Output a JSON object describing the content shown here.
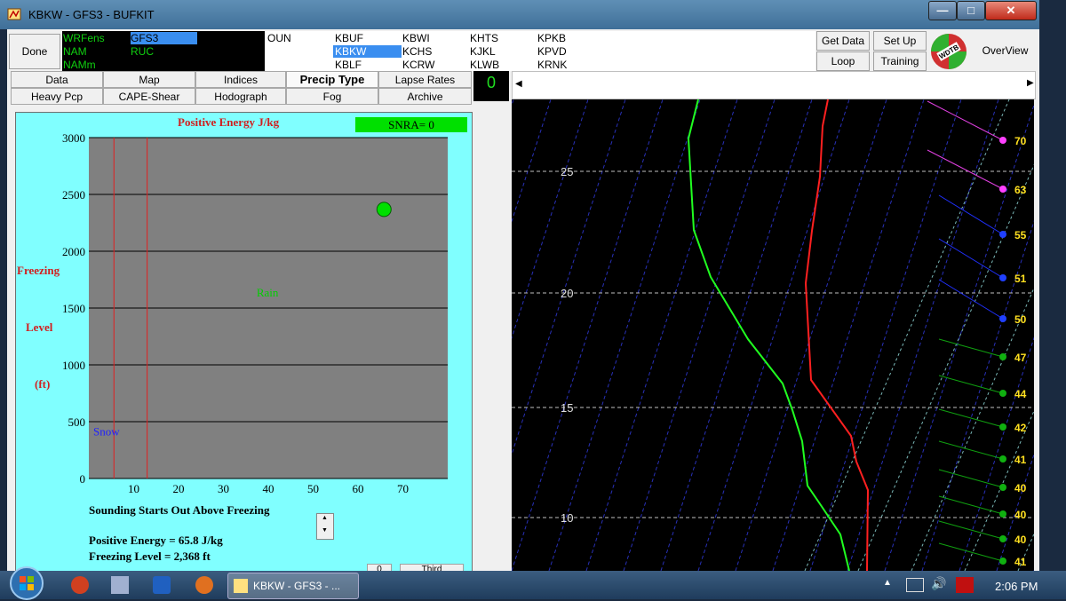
{
  "window": {
    "title": "KBKW - GFS3 - BUFKIT"
  },
  "controls": {
    "done": "Done"
  },
  "models": {
    "col1": [
      "WRFens",
      "NAM",
      "NAMm"
    ],
    "col2": [
      "GFS3",
      "RUC"
    ]
  },
  "stations": {
    "col0": [
      "OUN"
    ],
    "col1": [
      "KBUF",
      "KBKW",
      "KBLF"
    ],
    "col2": [
      "KBWI",
      "KCHS",
      "KCRW"
    ],
    "col3": [
      "KHTS",
      "KJKL",
      "KLWB"
    ],
    "col4": [
      "KPKB",
      "KPVD",
      "KRNK"
    ],
    "selected": "KBKW"
  },
  "right_buttons": {
    "get_data": "Get Data",
    "set_up": "Set Up",
    "loop": "Loop",
    "training": "Training",
    "overview": "OverView",
    "logo": "WDTB"
  },
  "tabs": {
    "row1": [
      "Data",
      "Map",
      "Indices",
      "Precip Type",
      "Lapse Rates"
    ],
    "row2": [
      "Heavy Pcp",
      "CAPE-Shear",
      "Hodograph",
      "Fog",
      "Archive"
    ]
  },
  "counter": "0",
  "energy_panel": {
    "title": "Positive Energy J/kg",
    "snra": "SNRA= 0",
    "ylabel": [
      "Freezing",
      "Level",
      "(ft)"
    ],
    "region_rain": "Rain",
    "region_snow": "Snow",
    "status": "Sounding Starts Out Above Freezing",
    "positive_energy": "Positive Energy = 65.8 J/kg",
    "freezing_level": "Freezing Level  = 2,368 ft",
    "bottom_btn_1": "0",
    "bottom_btn_2": "Third"
  },
  "chart_data": {
    "type": "scatter",
    "title": "Positive Energy J/kg",
    "ylabel": "Freezing Level (ft)",
    "xticks": [
      "10",
      "20",
      "30",
      "40",
      "50",
      "60",
      "70"
    ],
    "yticks": [
      "0",
      "500",
      "1000",
      "1500",
      "2000",
      "2500",
      "3000"
    ],
    "xlim": [
      0,
      80
    ],
    "ylim": [
      0,
      3000
    ],
    "threshold_lines_x": [
      5.6,
      13
    ],
    "points": [
      {
        "x": 65.8,
        "y": 2368
      }
    ],
    "point_color": "#00e000",
    "background": "#808080"
  },
  "sounding": {
    "pressure_labels": [
      "25",
      "20",
      "15",
      "10"
    ],
    "wind_labels": [
      "70",
      "63",
      "55",
      "51",
      "50",
      "47",
      "44",
      "42",
      "41",
      "40",
      "40",
      "40",
      "41"
    ],
    "colors": {
      "temp": "#ff2020",
      "dew": "#20ff20"
    }
  },
  "taskbar": {
    "task": "KBKW - GFS3 - ...",
    "time": "2:06 PM"
  }
}
